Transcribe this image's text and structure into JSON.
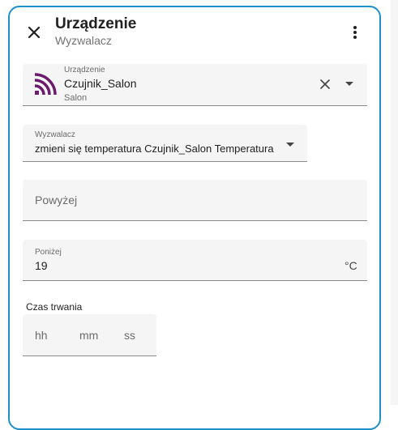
{
  "dialog": {
    "title": "Urządzenie",
    "subtitle": "Wyzwalacz",
    "close_icon": "close-icon",
    "menu_icon": "more-vertical-icon"
  },
  "device_field": {
    "label": "Urządzenie",
    "value": "Czujnik_Salon",
    "area": "Salon",
    "icon": "sensor-signal-icon",
    "icon_color": "#6a1b6e"
  },
  "trigger_field": {
    "label": "Wyzwalacz",
    "value": "zmieni się temperatura Czujnik_Salon Temperatura"
  },
  "above_field": {
    "placeholder": "Powyżej"
  },
  "below_field": {
    "label": "Poniżej",
    "value": "19",
    "unit": "°C"
  },
  "duration": {
    "label": "Czas trwania",
    "hours_placeholder": "hh",
    "minutes_placeholder": "mm",
    "seconds_placeholder": "ss"
  },
  "colors": {
    "accent_border": "#1e8fc8",
    "field_bg": "#f5f5f5"
  }
}
